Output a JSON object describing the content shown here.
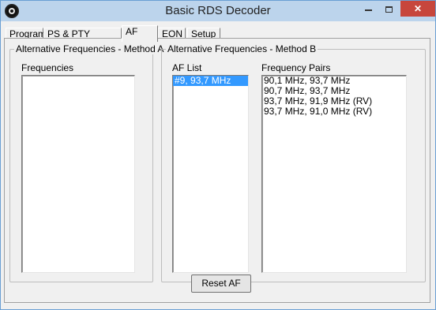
{
  "window": {
    "title": "Basic RDS Decoder",
    "close_glyph": "✕"
  },
  "tabs": [
    {
      "label": "Program"
    },
    {
      "label": "PS & PTY History"
    },
    {
      "label": "AF"
    },
    {
      "label": "EON"
    },
    {
      "label": "Setup"
    }
  ],
  "active_tab": "AF",
  "method_a": {
    "title": "Alternative Frequencies - Method A",
    "frequencies_label": "Frequencies",
    "frequencies": []
  },
  "method_b": {
    "title": "Alternative Frequencies - Method B",
    "af_list_label": "AF List",
    "af_list": [
      "#9, 93,7 MHz"
    ],
    "af_list_selected": "#9, 93,7 MHz",
    "pairs_label": "Frequency Pairs",
    "pairs": [
      "90,1 MHz, 93,7 MHz",
      "90,7 MHz, 93,7 MHz",
      "93,7 MHz, 91,9 MHz (RV)",
      "93,7 MHz, 91,0 MHz (RV)"
    ]
  },
  "reset_button": "Reset AF",
  "colors": {
    "titlebar": "#bcd4ec",
    "close": "#c7463c",
    "selection": "#3399ff"
  }
}
